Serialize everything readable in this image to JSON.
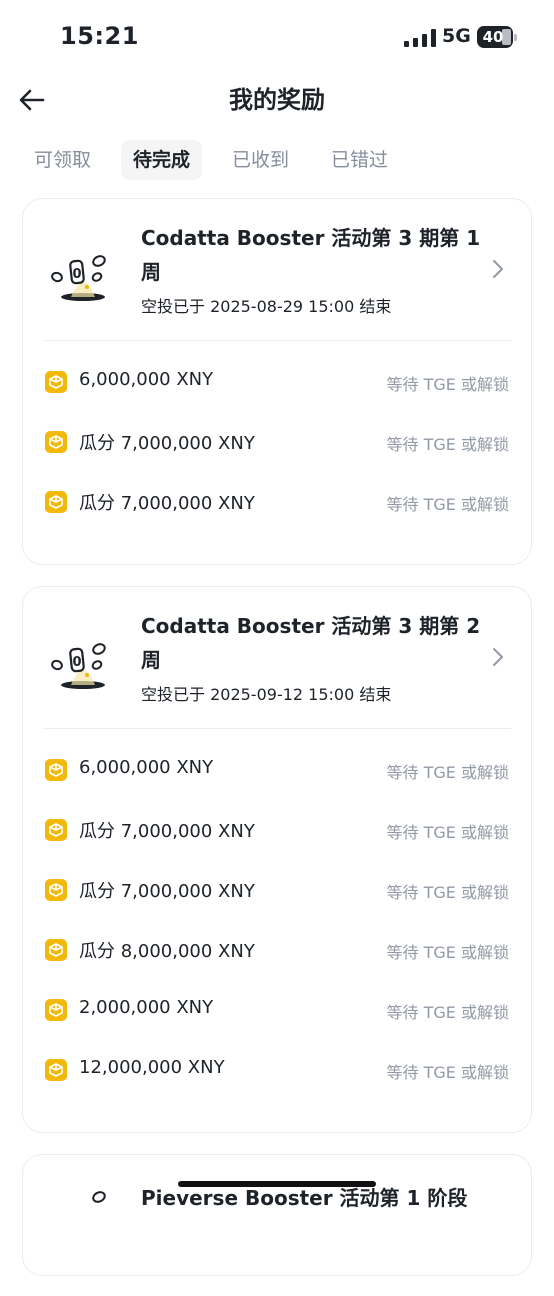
{
  "status_bar": {
    "time": "15:21",
    "network": "5G",
    "battery": "40"
  },
  "header": {
    "title": "我的奖励"
  },
  "tabs": [
    {
      "label": "可领取"
    },
    {
      "label": "待完成"
    },
    {
      "label": "已收到"
    },
    {
      "label": "已错过"
    }
  ],
  "active_tab": "待完成",
  "cards": [
    {
      "title": "Codatta Booster 活动第 3 期第 1 周",
      "subtitle": "空投已于 2025-08-29 15:00 结束",
      "rewards": [
        {
          "amount": "6,000,000 XNY",
          "status": "等待 TGE 或解锁"
        },
        {
          "amount": "瓜分 7,000,000 XNY",
          "status": "等待 TGE 或解锁"
        },
        {
          "amount": "瓜分 7,000,000 XNY",
          "status": "等待 TGE 或解锁"
        }
      ]
    },
    {
      "title": "Codatta Booster 活动第 3 期第 2 周",
      "subtitle": "空投已于 2025-09-12 15:00 结束",
      "rewards": [
        {
          "amount": "6,000,000 XNY",
          "status": "等待 TGE 或解锁"
        },
        {
          "amount": "瓜分 7,000,000 XNY",
          "status": "等待 TGE 或解锁"
        },
        {
          "amount": "瓜分 7,000,000 XNY",
          "status": "等待 TGE 或解锁"
        },
        {
          "amount": "瓜分 8,000,000 XNY",
          "status": "等待 TGE 或解锁"
        },
        {
          "amount": "2,000,000 XNY",
          "status": "等待 TGE 或解锁"
        },
        {
          "amount": "12,000,000 XNY",
          "status": "等待 TGE 或解锁"
        }
      ]
    },
    {
      "title": "Pieverse Booster 活动第 1 阶段",
      "subtitle": "",
      "rewards": []
    }
  ],
  "colors": {
    "accent": "#f0b90b",
    "text": "#1e2329",
    "muted": "#929aa5",
    "tab_active_bg": "#f5f5f5",
    "border": "#eaecef"
  }
}
